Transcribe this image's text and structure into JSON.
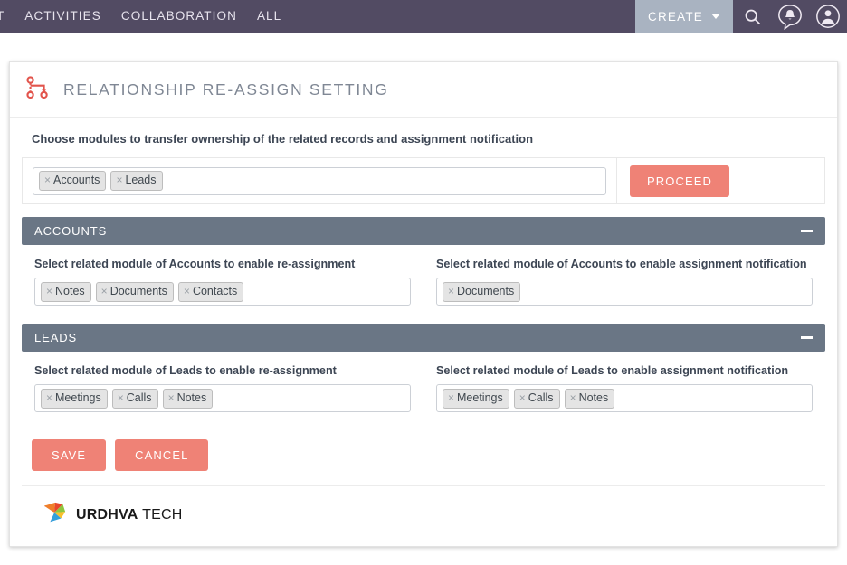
{
  "topnav": {
    "items": [
      {
        "label": "T",
        "clipped": true
      },
      {
        "label": "ACTIVITIES",
        "clipped": false
      },
      {
        "label": "COLLABORATION",
        "clipped": false
      },
      {
        "label": "ALL",
        "clipped": false
      }
    ],
    "create_label": "CREATE",
    "icons": [
      "search-icon",
      "notifications-icon",
      "user-account-icon"
    ],
    "bg_color": "#524b63",
    "create_bg_color": "#a9b3c1"
  },
  "header": {
    "title": "RELATIONSHIP RE-ASSIGN SETTING",
    "icon": "hierarchy-icon",
    "icon_color": "#e2544c"
  },
  "main": {
    "instruction": "Choose modules to transfer ownership of the related records and assignment notification",
    "module_tags": [
      {
        "remove": "×",
        "label": "Accounts"
      },
      {
        "remove": "×",
        "label": "Leads"
      }
    ],
    "proceed_label": "PROCEED"
  },
  "sections": [
    {
      "title": "ACCOUNTS",
      "collapse_icon": "minus-icon",
      "left": {
        "label": "Select related module of Accounts to enable re-assignment",
        "tags": [
          {
            "remove": "×",
            "label": "Notes"
          },
          {
            "remove": "×",
            "label": "Documents"
          },
          {
            "remove": "×",
            "label": "Contacts"
          }
        ]
      },
      "right": {
        "label": "Select related module of Accounts to enable assignment notification",
        "tags": [
          {
            "remove": "×",
            "label": "Documents"
          }
        ]
      }
    },
    {
      "title": "LEADS",
      "collapse_icon": "minus-icon",
      "left": {
        "label": "Select related module of Leads to enable re-assignment",
        "tags": [
          {
            "remove": "×",
            "label": "Meetings"
          },
          {
            "remove": "×",
            "label": "Calls"
          },
          {
            "remove": "×",
            "label": "Notes"
          }
        ]
      },
      "right": {
        "label": "Select related module of Leads to enable assignment notification",
        "tags": [
          {
            "remove": "×",
            "label": "Meetings"
          },
          {
            "remove": "×",
            "label": "Calls"
          },
          {
            "remove": "×",
            "label": "Notes"
          }
        ]
      }
    }
  ],
  "actions": {
    "save_label": "SAVE",
    "cancel_label": "CANCEL",
    "button_color": "#ef8276"
  },
  "footer": {
    "logo_name": "URDHVA",
    "logo_suffix": "TECH",
    "logo_icon": "urdhva-fan-logo"
  },
  "colors": {
    "accent": "#ef8276",
    "section_header": "#6a7685",
    "nav": "#524b63",
    "title_text": "#7f8794"
  }
}
